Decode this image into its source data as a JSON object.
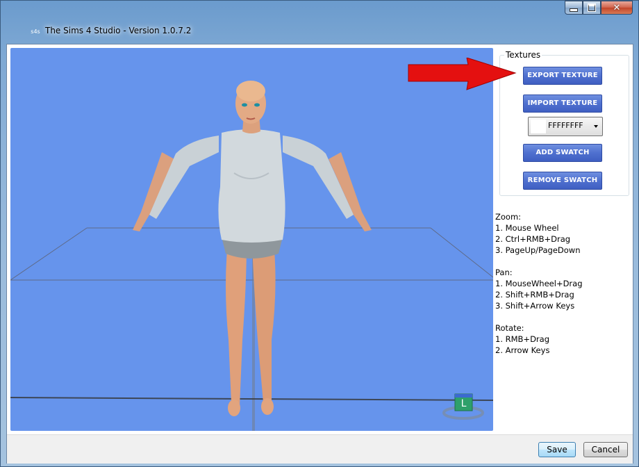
{
  "window": {
    "title": "The Sims 4 Studio - Version 1.0.7.2",
    "icon_text": "s4s"
  },
  "textures": {
    "group_label": "Textures",
    "export_label": "EXPORT TEXTURE",
    "import_label": "IMPORT TEXTURE",
    "color_value": "FFFFFFFF",
    "add_swatch_label": "ADD SWATCH",
    "remove_swatch_label": "REMOVE SWATCH"
  },
  "help": {
    "zoom": {
      "heading": "Zoom:",
      "items": [
        "1. Mouse Wheel",
        "2. Ctrl+RMB+Drag",
        "3. PageUp/PageDown"
      ]
    },
    "pan": {
      "heading": "Pan:",
      "items": [
        "1. MouseWheel+Drag",
        "2. Shift+RMB+Drag",
        "3. Shift+Arrow Keys"
      ]
    },
    "rotate": {
      "heading": "Rotate:",
      "items": [
        "1. RMB+Drag",
        "2. Arrow Keys"
      ]
    }
  },
  "viewport": {
    "background": "#6694ec",
    "gizmo_label": "L"
  },
  "footer": {
    "save_label": "Save",
    "cancel_label": "Cancel"
  },
  "colors": {
    "button_blue": "#4f70cf",
    "arrow_red": "#e41010"
  }
}
